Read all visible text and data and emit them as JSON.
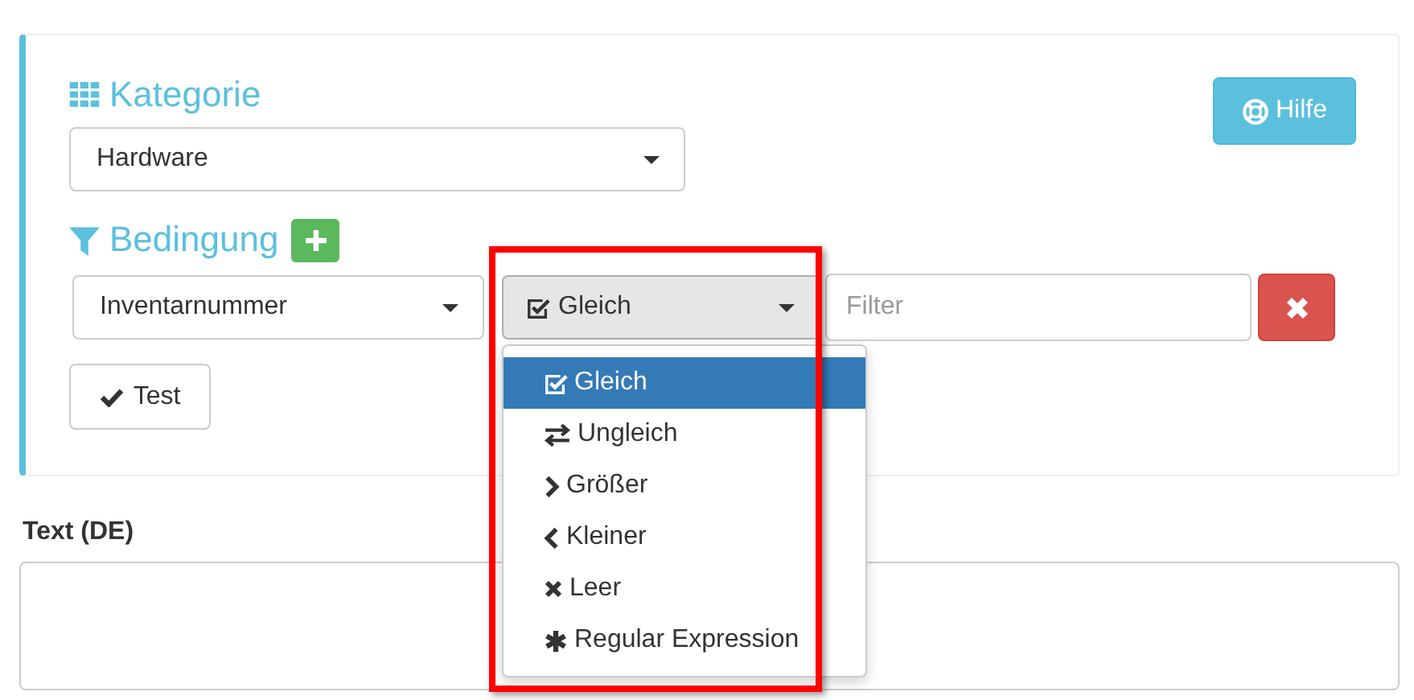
{
  "kategorie": {
    "title": "Kategorie",
    "select": {
      "value": "Hardware"
    }
  },
  "help_button": {
    "label": "Hilfe"
  },
  "bedingung": {
    "title": "Bedingung",
    "field_select": {
      "value": "Inventarnummer"
    },
    "operator_select": {
      "value": "Gleich",
      "kind": "equal",
      "expanded": true
    },
    "filter": {
      "placeholder": "Filter"
    },
    "options": [
      {
        "label": "Gleich",
        "kind": "equal",
        "selected": true
      },
      {
        "label": "Ungleich",
        "kind": "unequal",
        "selected": false
      },
      {
        "label": "Größer",
        "kind": "greater",
        "selected": false
      },
      {
        "label": "Kleiner",
        "kind": "less",
        "selected": false
      },
      {
        "label": "Leer",
        "kind": "empty",
        "selected": false
      },
      {
        "label": "Regular Expression",
        "kind": "regex",
        "selected": false
      }
    ]
  },
  "test_button": {
    "label": "Test"
  },
  "text_field": {
    "label": "Text (DE)"
  }
}
